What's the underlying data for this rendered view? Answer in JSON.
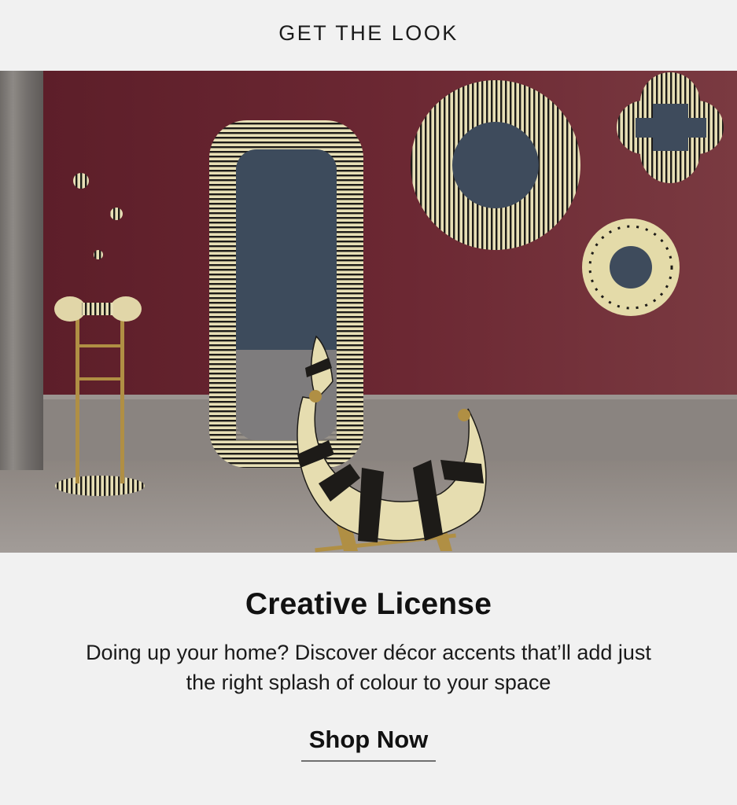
{
  "header": {
    "title": "GET THE LOOK"
  },
  "hero": {
    "image_icon": "hero-photo",
    "wall_color": "#6e2734",
    "floor_color": "#8f8985"
  },
  "content": {
    "headline": "Creative License",
    "subtext": "Doing up your home? Discover décor accents that’ll add just the right splash of colour to your space",
    "cta_label": "Shop Now"
  }
}
